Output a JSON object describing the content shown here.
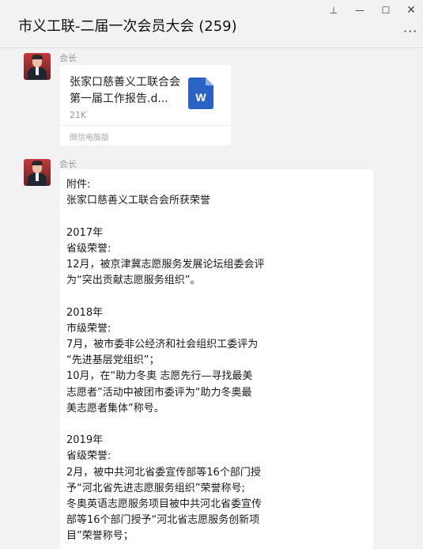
{
  "window": {
    "title": "市义工联-二届一次会员大会 (259)",
    "controls": {
      "pin": "⊥",
      "minimize": "—",
      "maximize": "☐",
      "close": "✕",
      "more": "···"
    }
  },
  "messages": [
    {
      "sender": "会长",
      "type": "file",
      "file": {
        "name": "张家口慈善义工联合会第一届工作报告.d...",
        "size": "21K",
        "source": "微信电脑版",
        "icon": "word-doc-icon",
        "icon_letter": "W"
      }
    },
    {
      "sender": "会长",
      "type": "text",
      "text": "附件:\n张家口慈善义工联合会所获荣誉\n\n2017年\n省级荣誉:\n12月，被京津冀志愿服务发展论坛组委会评\n为“突出贡献志愿服务组织”。\n\n2018年\n市级荣誉:\n7月，被市委非公经济和社会组织工委评为\n“先进基层党组织”；\n10月，在“助力冬奥 志愿先行—寻找最美\n志愿者”活动中被团市委评为“助力冬奥最\n美志愿者集体”称号。\n\n2019年\n省级荣誉:\n2月，被中共河北省委宣传部等16个部门授\n予“河北省先进志愿服务组织”荣誉称号;\n冬奥英语志愿服务项目被中共河北省委宣传\n部等16个部门授予“河北省志愿服务创新项\n目”荣誉称号；"
    }
  ],
  "colors": {
    "window_bg": "#f2f2f2",
    "bubble_bg": "#ffffff",
    "word_blue": "#2b63c4",
    "sender_gray": "#9a9a9a"
  }
}
